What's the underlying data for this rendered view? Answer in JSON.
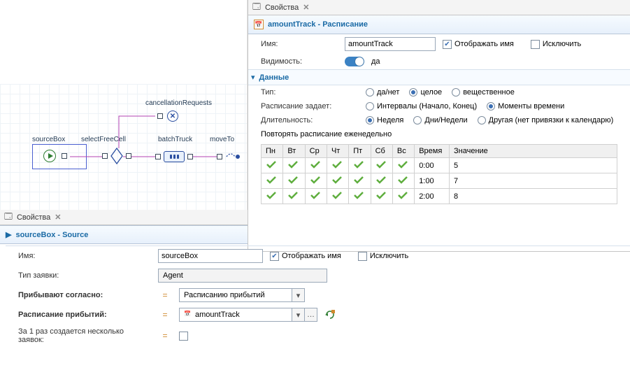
{
  "right": {
    "tab": "Свойства",
    "title": "amountTrack - Расписание",
    "nameLabel": "Имя:",
    "nameValue": "amountTrack",
    "showNameChecked": true,
    "showNameLabel": "Отображать имя",
    "excludeLabel": "Исключить",
    "visibilityLabel": "Видимость:",
    "visibilityValue": "да",
    "dataSection": "Данные",
    "typeLabel": "Тип:",
    "typeOptions": [
      "да/нет",
      "целое",
      "вещественное"
    ],
    "typeSelected": "целое",
    "schedDefinesLabel": "Расписание задает:",
    "schedDefinesOptions": [
      "Интервалы (Начало, Конец)",
      "Моменты времени"
    ],
    "schedDefinesSelected": "Моменты времени",
    "durationLabel": "Длительность:",
    "durationOptions": [
      "Неделя",
      "Дни/Недели",
      "Другая (нет привязки к календарю)"
    ],
    "durationSelected": "Неделя",
    "repeatLabel": "Повторять расписание еженедельно",
    "days": [
      "Пн",
      "Вт",
      "Ср",
      "Чт",
      "Пт",
      "Сб",
      "Вс"
    ],
    "timeHeader": "Время",
    "valueHeader": "Значение",
    "rows": [
      {
        "time": "0:00",
        "value": "5"
      },
      {
        "time": "1:00",
        "value": "7"
      },
      {
        "time": "2:00",
        "value": "8"
      }
    ]
  },
  "canvas": {
    "cancellation": "cancellationRequests",
    "sourceBox": "sourceBox",
    "selectFreeCell": "selectFreeCell",
    "batchTruck": "batchTruck",
    "moveTo": "moveTo"
  },
  "left": {
    "tab": "Свойства",
    "title": "sourceBox - Source"
  },
  "bottom": {
    "nameLabel": "Имя:",
    "nameValue": "sourceBox",
    "showNameLabel": "Отображать имя",
    "showNameChecked": true,
    "excludeLabel": "Исключить",
    "agentTypeLabel": "Тип заявки:",
    "agentTypeValue": "Agent",
    "arriveLabel": "Прибывают согласно:",
    "arriveValue": "Расписанию прибытий",
    "arriveSchedLabel": "Расписание прибытий:",
    "arriveSchedValue": "amountTrack",
    "multipleLabel": "За 1 раз создается несколько заявок:"
  }
}
